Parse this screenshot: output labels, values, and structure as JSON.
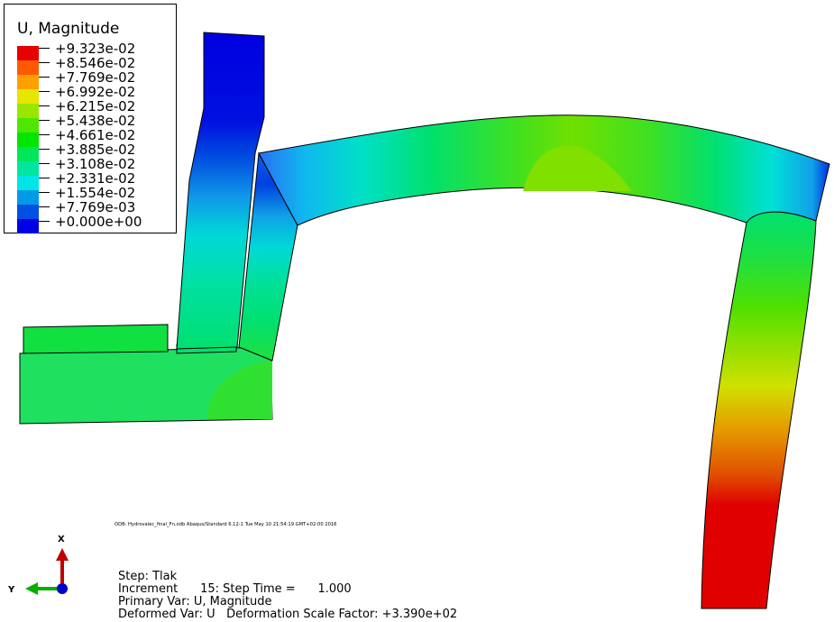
{
  "legend": {
    "title": "U, Magnitude",
    "entries": [
      {
        "label": "+9.323e-02",
        "color": "#e60000"
      },
      {
        "label": "+8.546e-02",
        "color": "#ff5a00"
      },
      {
        "label": "+7.769e-02",
        "color": "#ffa000"
      },
      {
        "label": "+6.992e-02",
        "color": "#e6e600"
      },
      {
        "label": "+6.215e-02",
        "color": "#9ae600"
      },
      {
        "label": "+5.438e-02",
        "color": "#4fe600"
      },
      {
        "label": "+4.661e-02",
        "color": "#00e600"
      },
      {
        "label": "+3.885e-02",
        "color": "#00e65a"
      },
      {
        "label": "+3.108e-02",
        "color": "#00e6a0"
      },
      {
        "label": "+2.331e-02",
        "color": "#00e6e6"
      },
      {
        "label": "+1.554e-02",
        "color": "#009ae6"
      },
      {
        "label": "+7.769e-03",
        "color": "#0050e6"
      },
      {
        "label": "+0.000e+00",
        "color": "#0000e6"
      }
    ]
  },
  "odb_line": "ODB: Hydrovalec_final_Fn.odb    Abaqus/Standard 6.12-1    Tue May 10 21:54:19 GMT+02:00 2016",
  "triad": {
    "x_label": "X",
    "y_label": "Y",
    "x_color": "#c00000",
    "y_color": "#00b000",
    "origin_color": "#0000cc"
  },
  "info": {
    "step": "Step: Tlak",
    "increment": "Increment      15: Step Time =      1.000",
    "primary": "Primary Var: U, Magnitude",
    "deformed": "Deformed Var: U   Deformation Scale Factor: +3.390e+02"
  }
}
